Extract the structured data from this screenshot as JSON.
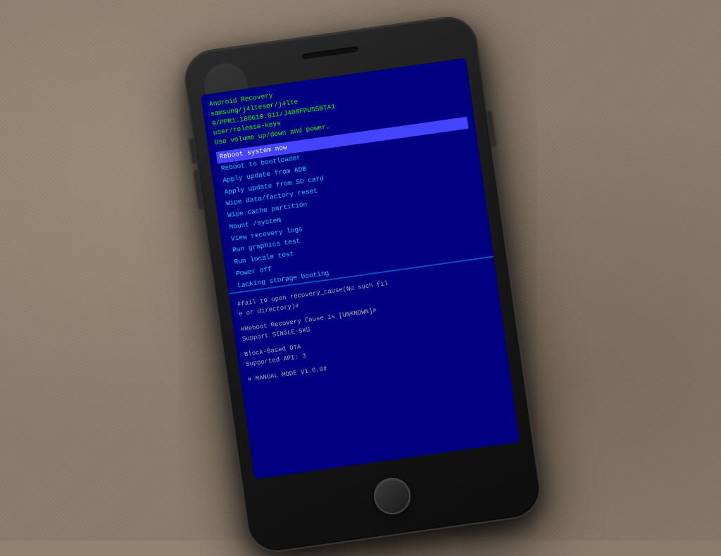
{
  "background": {
    "color": "#8a7a6a"
  },
  "phone": {
    "device_info": {
      "line1": "Android Recovery",
      "line2": "samsung/j4lteser/j4lte",
      "line3": "9/PPR1.180610.011/J400FPUS5BTA1",
      "line4": "user/release-keys",
      "line5": "Use volume up/down and power."
    },
    "menu": {
      "items": [
        {
          "label": "Reboot system now",
          "selected": true
        },
        {
          "label": "Reboot to bootloader",
          "selected": false
        },
        {
          "label": "Apply update from ADB",
          "selected": false
        },
        {
          "label": "Apply update from SD card",
          "selected": false
        },
        {
          "label": "Wipe data/factory reset",
          "selected": false
        },
        {
          "label": "Wipe cache partition",
          "selected": false
        },
        {
          "label": "Mount /system",
          "selected": false
        },
        {
          "label": "View recovery logs",
          "selected": false
        },
        {
          "label": "Run graphics test",
          "selected": false
        },
        {
          "label": "Run locale test",
          "selected": false
        },
        {
          "label": "Power off",
          "selected": false
        },
        {
          "label": "Lacking storage booting",
          "selected": false
        }
      ]
    },
    "log": {
      "lines": [
        "#fail to open recovery_cause(No such fil",
        "e or directory)#",
        "",
        "#Reboot Recovery Cause is [UNKNOWN]#",
        "Support SINGLE-SKU",
        "",
        "Block-Based OTA",
        "Supported API: 3",
        "",
        "# MANUAL MODE v1.0.0#"
      ]
    }
  }
}
